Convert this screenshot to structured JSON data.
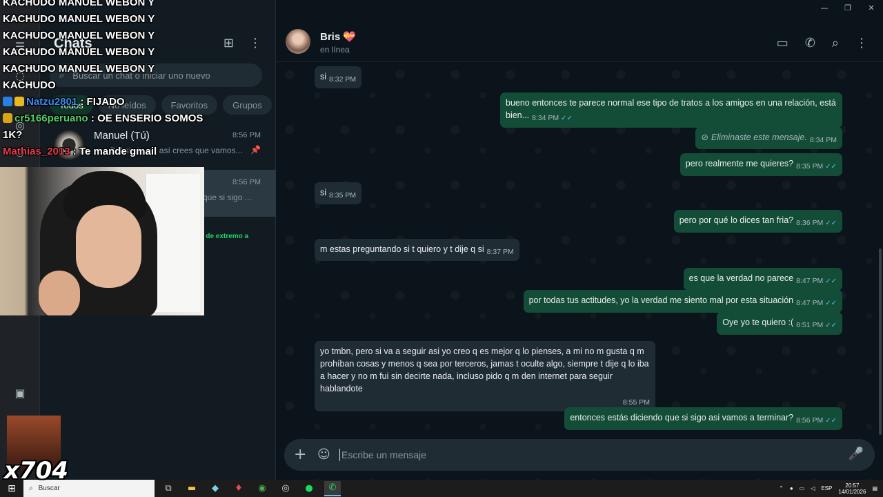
{
  "window": {
    "minimize": "—",
    "maximize": "❐",
    "close": "✕"
  },
  "rail": {
    "icons": [
      "chat-icon",
      "status-icon",
      "channels-icon",
      "communities-icon",
      "media-icon"
    ]
  },
  "list": {
    "title": "Chats",
    "search_placeholder": "Buscar un chat o iniciar uno nuevo",
    "chips": [
      "Todos",
      "No leídos",
      "Favoritos",
      "Grupos"
    ],
    "chats": [
      {
        "name": "Manuel (Tú)",
        "time": "8:56 PM",
        "preview": "✓✓ Del si sigues así crees que vamos..."
      },
      {
        "name": "",
        "time": "8:56 PM",
        "preview": "que si sigo ..."
      }
    ],
    "green_snippet": "s de extremo a"
  },
  "overlay": {
    "lines": [
      "KACHUDO MANUEL WEBON Y KACHUDO MANUEL WEBON Y KACHUDO MANUEL WEBON Y KACHUDO MANUEL WEBON Y KACHUDO MANUEL WEBON Y KACHUDO"
    ],
    "messages": [
      {
        "user": "Natzu2801",
        "text": ": FIJADO"
      },
      {
        "user": "cr5166peruano",
        "text": ": OE ENSERIO SOMOS 1K?"
      },
      {
        "user": "Mathias_2013",
        "text": ": Te mande gmail"
      }
    ],
    "counter": "x704"
  },
  "conversation": {
    "contact_name": "Bris 💝",
    "status": "en línea",
    "composer_placeholder": "Escribe un mensaje",
    "messages": [
      {
        "dir": "in",
        "text": "si",
        "time": "8:32 PM"
      },
      {
        "dir": "out",
        "text": "bueno entonces te parece normal ese tipo de tratos a los amigos en una relación, está bien...",
        "time": "8:34 PM"
      },
      {
        "dir": "out",
        "text": "Eliminaste este mensaje.",
        "time": "8:34 PM",
        "deleted": true
      },
      {
        "dir": "out",
        "text": "pero realmente me quieres?",
        "time": "8:35 PM"
      },
      {
        "dir": "in",
        "text": "si",
        "time": "8:35 PM"
      },
      {
        "dir": "out",
        "text": "pero por qué lo dices tan fria?",
        "time": "8:36 PM"
      },
      {
        "dir": "in",
        "text": "m estas preguntando si t quiero y t dije q si",
        "time": "8:37 PM"
      },
      {
        "dir": "out",
        "text": "es que la verdad no parece",
        "time": "8:47 PM"
      },
      {
        "dir": "out",
        "text": "por todas tus actitudes, yo la verdad me siento mal por esta situación",
        "time": "8:47 PM"
      },
      {
        "dir": "out",
        "text": "Oye yo te quiero :(",
        "time": "8:51 PM"
      },
      {
        "dir": "in",
        "text": "yo tmbn, pero si va a seguir asi yo creo q es mejor q lo pienses, a mi no m gusta q m prohíban cosas y menos q sea por terceros, jamas t oculte algo, siempre t dije q lo iba a hacer y no m fui sin decirte nada, incluso pido q m den internet para seguir hablandote",
        "time": "8:55 PM"
      },
      {
        "dir": "out",
        "text": "entonces estás diciendo que si sigo asi vamos a terminar?",
        "time": "8:56 PM"
      }
    ]
  },
  "taskbar": {
    "search_label": "Buscar",
    "language": "ESP",
    "time": "20:57",
    "date": "14/01/2026"
  }
}
